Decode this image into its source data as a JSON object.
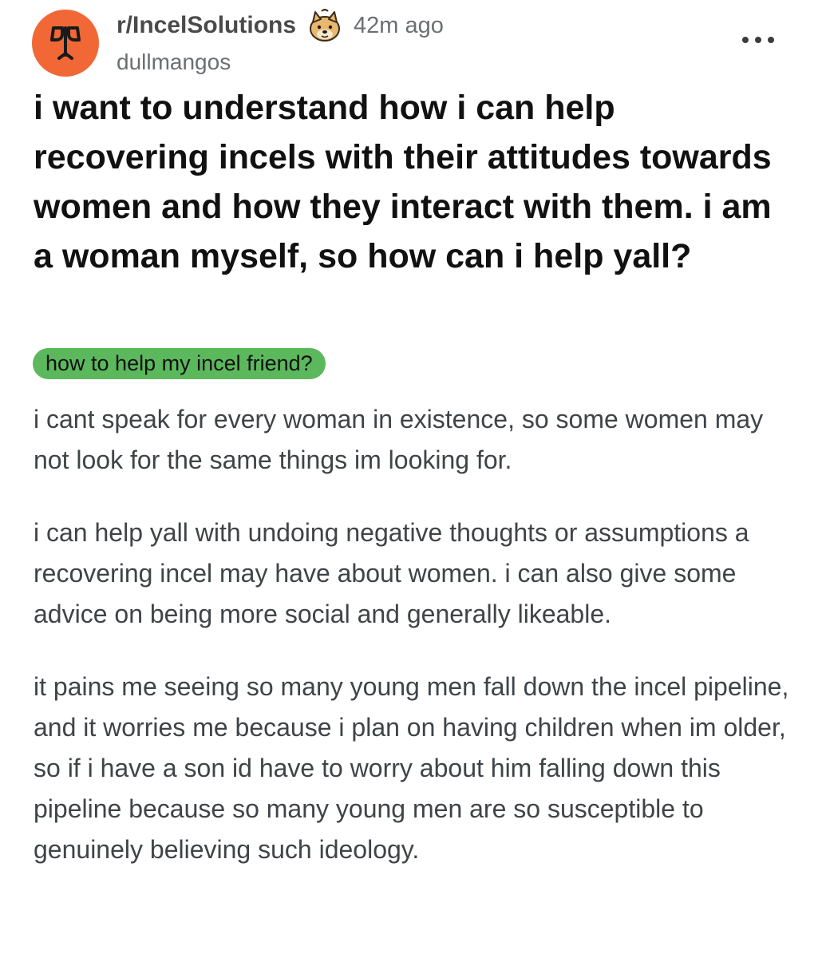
{
  "post": {
    "subreddit": "r/IncelSolutions",
    "time_ago": "42m ago",
    "author": "dullmangos",
    "title": "i want to understand how i can help recovering incels with their attitudes towards women and how they interact with them. i am a woman myself, so how can i help yall?",
    "flair": "how to help my incel friend?",
    "paragraphs": [
      "i cant speak for every woman in existence, so some women may not look for the same things im looking for.",
      "i can help yall with undoing negative thoughts or assumptions a recovering incel may have about women. i can also give some advice on being more social and generally likeable.",
      "it pains me seeing so many young men fall down the incel pipeline, and it worries me because i plan on having children when im older, so if i have a son id have to worry about him falling down this pipeline because so many young men are so susceptible to genuinely believing such ideology."
    ]
  },
  "icons": {
    "subreddit_avatar": "sprout-icon",
    "author_badge": "doge-icon",
    "more": "more-options-icon"
  },
  "colors": {
    "avatar_bg": "#f16836",
    "flair_bg": "#5cb85c",
    "meta_text": "#6b6f72",
    "body_text": "#3f4447",
    "title_text": "#111111"
  }
}
